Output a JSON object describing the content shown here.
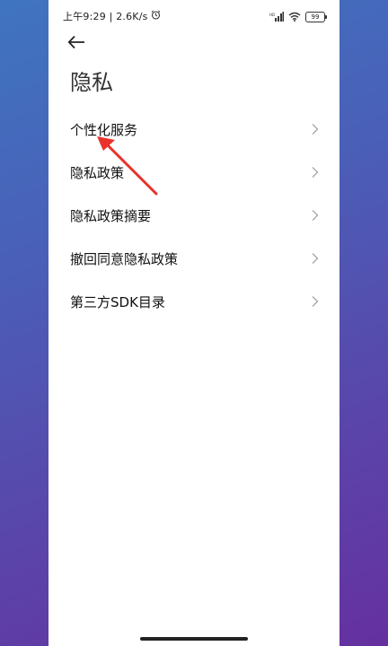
{
  "status_bar": {
    "time_speed": "上午9:29 | 2.6K/s",
    "battery": "99",
    "icons": [
      "alarm-icon",
      "signal-icon",
      "wifi-icon",
      "battery-icon"
    ]
  },
  "header": {
    "back_icon": "back-arrow-icon",
    "title": "隐私"
  },
  "menu": {
    "items": [
      {
        "label": "个性化服务"
      },
      {
        "label": "隐私政策"
      },
      {
        "label": "隐私政策摘要"
      },
      {
        "label": "撤回同意隐私政策"
      },
      {
        "label": "第三方SDK目录"
      }
    ],
    "chevron_icon": "chevron-right-icon"
  },
  "annotation": {
    "arrow_color": "#e8322b"
  }
}
